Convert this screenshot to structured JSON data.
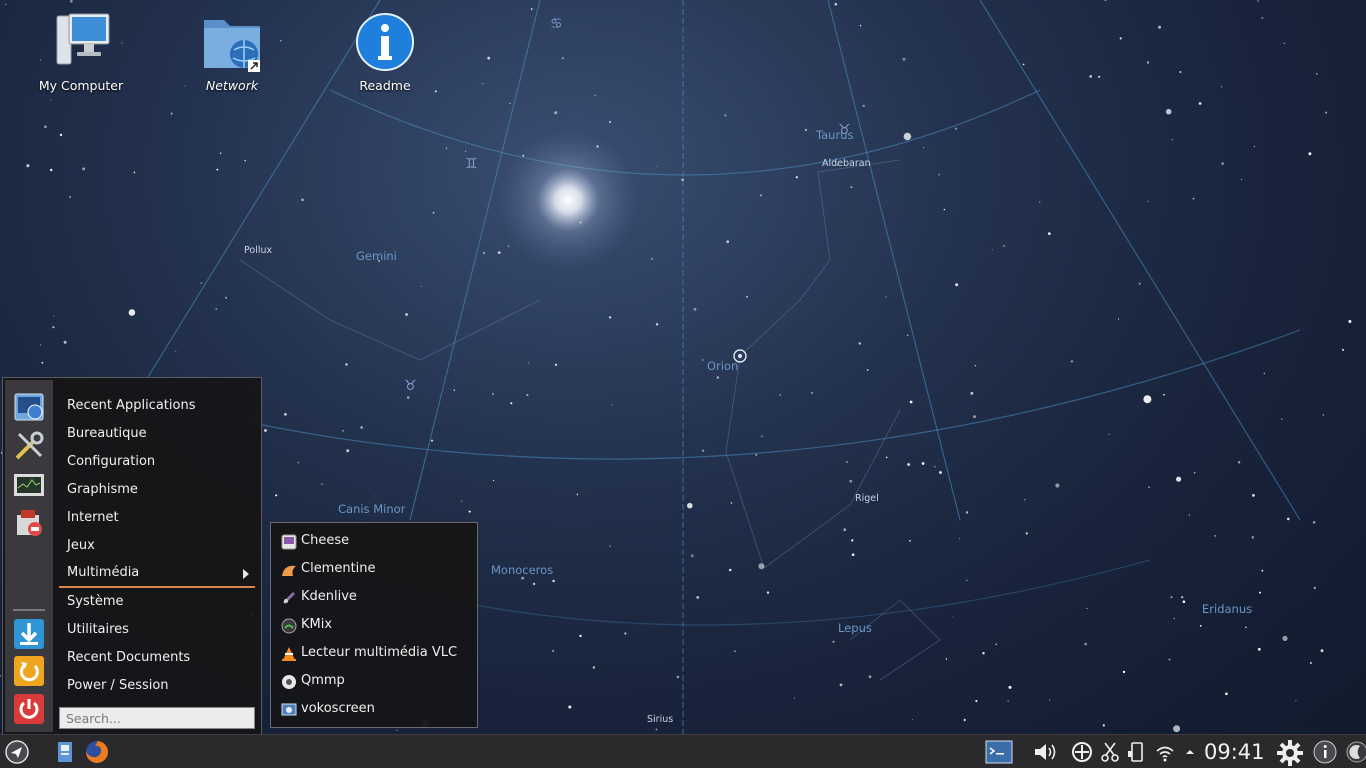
{
  "sky_labels": [
    {
      "text": "Taurus"
    },
    {
      "text": "Aldebaran"
    },
    {
      "text": "Pollux"
    },
    {
      "text": "Gemini"
    },
    {
      "text": "Orion"
    },
    {
      "text": "Canis Minor"
    },
    {
      "text": "Monoceros"
    },
    {
      "text": "Rigel"
    },
    {
      "text": "Lepus"
    },
    {
      "text": "Eridanus"
    },
    {
      "text": "Sirius"
    }
  ],
  "desktop": {
    "icons": [
      {
        "label": "My Computer",
        "icon": "computer-icon"
      },
      {
        "label": "Network",
        "icon": "network-folder-icon"
      },
      {
        "label": "Readme",
        "icon": "info-icon"
      }
    ]
  },
  "start_menu": {
    "strip_icons": [
      "favorites-icon",
      "settings-tools-icon",
      "system-monitor-icon",
      "software-installer-icon",
      "lock-screen-icon",
      "restart-icon",
      "shutdown-icon"
    ],
    "items": [
      {
        "label": "Recent Applications"
      },
      {
        "label": "Bureautique"
      },
      {
        "label": "Configuration"
      },
      {
        "label": "Graphisme"
      },
      {
        "label": "Internet"
      },
      {
        "label": "Jeux"
      },
      {
        "label": "Multimédia",
        "active": true
      },
      {
        "label": "Système"
      },
      {
        "label": "Utilitaires"
      },
      {
        "label": "Recent Documents"
      },
      {
        "label": "Power / Session"
      }
    ],
    "search_placeholder": "Search..."
  },
  "submenu": {
    "items": [
      {
        "label": "Cheese",
        "icon": "cheese-icon"
      },
      {
        "label": "Clementine",
        "icon": "clementine-icon"
      },
      {
        "label": "Kdenlive",
        "icon": "kdenlive-icon"
      },
      {
        "label": "KMix",
        "icon": "kmix-icon"
      },
      {
        "label": "Lecteur multimédia VLC",
        "icon": "vlc-icon"
      },
      {
        "label": "Qmmp",
        "icon": "qmmp-icon"
      },
      {
        "label": "vokoscreen",
        "icon": "vokoscreen-icon"
      }
    ]
  },
  "taskbar": {
    "clock": "09:41",
    "launchers": [
      "app-launcher-icon",
      "file-manager-icon",
      "firefox-icon"
    ],
    "tray": [
      "terminal-icon",
      "volume-icon",
      "network-manager-icon",
      "clipboard-icon",
      "device-notifier-icon",
      "wifi-icon",
      "tray-expand-icon",
      "settings-gear-icon",
      "info-icon",
      "desktop-toolbox-icon"
    ]
  }
}
